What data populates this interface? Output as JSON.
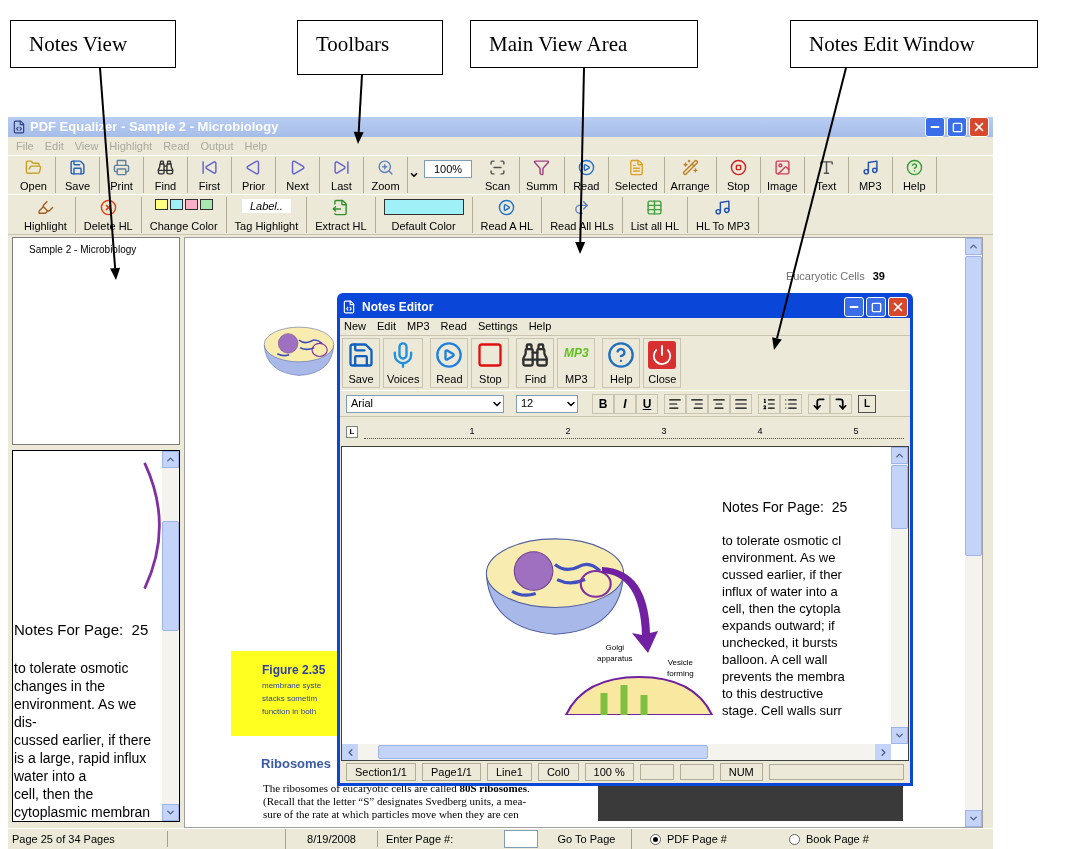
{
  "callouts": [
    {
      "label": "Notes View"
    },
    {
      "label": "Toolbars"
    },
    {
      "label": "Main View Area"
    },
    {
      "label": "Notes Edit Window"
    }
  ],
  "window": {
    "title": "PDF Equalizer - Sample 2 - Microbiology"
  },
  "menu": [
    {
      "label": "File",
      "disabled": true
    },
    {
      "label": "Edit",
      "disabled": true
    },
    {
      "label": "View",
      "disabled": true
    },
    {
      "label": "Highlight",
      "disabled": true
    },
    {
      "label": "Read",
      "disabled": true
    },
    {
      "label": "Output",
      "disabled": true
    },
    {
      "label": "Help",
      "disabled": true
    }
  ],
  "toolbar": [
    {
      "kind": "button",
      "label": "Open"
    },
    {
      "kind": "button",
      "label": "Save"
    },
    {
      "kind": "button",
      "label": "Print"
    },
    {
      "kind": "button",
      "label": "Find"
    },
    {
      "kind": "button",
      "label": "First"
    },
    {
      "kind": "button",
      "label": "Prior"
    },
    {
      "kind": "button",
      "label": "Next"
    },
    {
      "kind": "button",
      "label": "Last"
    },
    {
      "kind": "button",
      "label": "Zoom"
    },
    {
      "kind": "dropdown"
    },
    {
      "kind": "field",
      "value": "100%"
    },
    {
      "kind": "button",
      "label": "Scan"
    },
    {
      "kind": "button",
      "label": "Summ"
    },
    {
      "kind": "button",
      "label": "Read"
    },
    {
      "kind": "button",
      "label": "Selected"
    },
    {
      "kind": "button",
      "label": "Arrange"
    },
    {
      "kind": "button",
      "label": "Stop"
    },
    {
      "kind": "button",
      "label": "Image"
    },
    {
      "kind": "button",
      "label": "Text"
    },
    {
      "kind": "button",
      "label": "MP3"
    },
    {
      "kind": "button",
      "label": "Help"
    }
  ],
  "highlight_toolbar": [
    {
      "kind": "button",
      "label": "Highlight"
    },
    {
      "kind": "button",
      "label": "Delete HL"
    },
    {
      "kind": "swatches",
      "label": "Change Color",
      "swatches": [
        {
          "color": "#ffff80"
        },
        {
          "color": "#a0f0f8"
        },
        {
          "color": "#f8b0c8"
        },
        {
          "color": "#a8e8b0"
        }
      ]
    },
    {
      "kind": "tag",
      "label": "Tag Highlight",
      "tag": "Label.."
    },
    {
      "kind": "button",
      "label": "Extract HL"
    },
    {
      "kind": "swatch",
      "label": "Default Color",
      "color": "#a0f0f8"
    },
    {
      "kind": "button",
      "label": "Read A HL"
    },
    {
      "kind": "button",
      "label": "Read All HLs"
    },
    {
      "kind": "button",
      "label": "List all HL"
    },
    {
      "kind": "button",
      "label": "HL To MP3"
    }
  ],
  "tree": {
    "items": [
      {
        "label": "Sample 2 - Microbiology"
      }
    ]
  },
  "notes_view": {
    "heading": "Notes For Page:  25",
    "text": "to tolerate osmotic\nchanges in the\nenvironment. As we\ndis-\ncussed earlier, if there\nis a large, rapid influx\nwater into a\ncell, then the\ncytoplasmic membran"
  },
  "page": {
    "running_head": "Eucaryotic Cells",
    "page_number": "39",
    "figure": {
      "title": "Figure 2.35",
      "text": "membrane syste\nstacks sometim\nfunction in both"
    },
    "section_heading": "Ribosomes",
    "paragraph": "The ribosomes of eucaryotic cells are called **80S ribosomes**.\n(Recall that the letter “S” designates Svedberg units, a mea-\nsure of the rate at which particles move when they are cen"
  },
  "editor": {
    "title": "Notes Editor",
    "menu": [
      {
        "label": "New"
      },
      {
        "label": "Edit"
      },
      {
        "label": "MP3"
      },
      {
        "label": "Read"
      },
      {
        "label": "Settings"
      },
      {
        "label": "Help"
      }
    ],
    "toolbar": [
      {
        "label": "Save"
      },
      {
        "label": "Voices"
      },
      {
        "label": "Read"
      },
      {
        "label": "Stop"
      },
      {
        "label": "Find"
      },
      {
        "label": "MP3",
        "logo": "MP3"
      },
      {
        "label": "Help"
      },
      {
        "label": "Close"
      }
    ],
    "font": "Arial",
    "size": "12",
    "format_buttons": [
      {
        "label": "B"
      },
      {
        "label": "I"
      },
      {
        "label": "U"
      }
    ],
    "tab_button": "L",
    "ruler": {
      "tab_button": "L",
      "marks": [
        "1",
        "2",
        "3",
        "4",
        "5"
      ]
    },
    "image_labels": [
      "Golgi\napparatus",
      "Vesicle\nforming"
    ],
    "heading": "Notes For Page:  25",
    "text": "to tolerate osmotic cl\nenvironment. As we\ncussed earlier, if ther\ninflux of water into a\ncell, then the cytopla\nexpands outward; if\nunchecked, it bursts\nballoon. A cell wall\nprevents the membra\nto this destructive\nstage. Cell walls surr",
    "status": [
      {
        "kind": "text",
        "text": "Section1/1"
      },
      {
        "kind": "text",
        "text": "Page1/1"
      },
      {
        "kind": "text",
        "text": "Line1"
      },
      {
        "kind": "text",
        "text": "Col0"
      },
      {
        "kind": "text",
        "text": "100 %"
      },
      {
        "kind": "blank"
      },
      {
        "kind": "blank"
      },
      {
        "kind": "text",
        "text": "NUM"
      },
      {
        "kind": "blank"
      }
    ]
  },
  "status_bar": {
    "page_info": "Page 25 of 34 Pages",
    "date": "8/19/2008",
    "page_label": "Enter Page #:",
    "go_button": "Go To Page",
    "options": [
      {
        "label": "PDF Page #",
        "selected": true
      },
      {
        "label": "Book Page #",
        "selected": false
      }
    ]
  }
}
